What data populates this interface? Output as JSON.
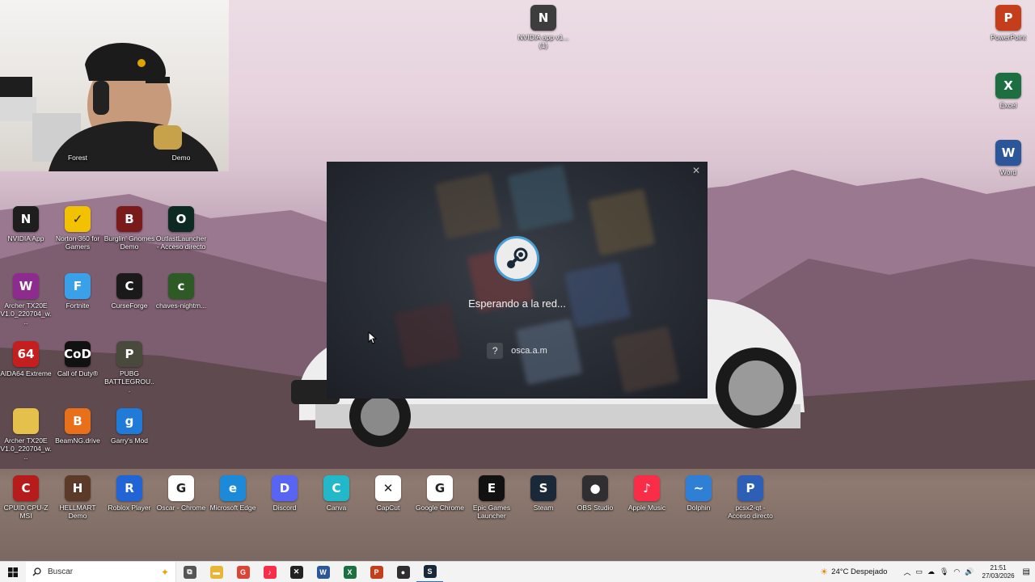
{
  "desktop_icons": [
    {
      "label": "",
      "color": "#2c2c2c",
      "glyph": ""
    },
    {
      "label": "NVIDIA app v1... (1)",
      "color": "#3d3d3d",
      "glyph": "N"
    },
    {
      "label": "PowerPoint",
      "color": "#c43e1c",
      "glyph": "P"
    },
    {
      "label": "Excel",
      "color": "#1d6f42",
      "glyph": "X"
    },
    {
      "label": "Word",
      "color": "#2b579a",
      "glyph": "W"
    },
    {
      "label": "Forest",
      "color": "#000",
      "glyph": ""
    },
    {
      "label": "Demo",
      "color": "#000",
      "glyph": ""
    },
    {
      "label": "NVIDIA App",
      "color": "#1e1e1e",
      "glyph": "N"
    },
    {
      "label": "Norton 360 for Gamers",
      "color": "#f2c200",
      "glyph": "✓"
    },
    {
      "label": "Burglin' Gnomes Demo",
      "color": "#7a1b1b",
      "glyph": "B"
    },
    {
      "label": "OutlastLauncher - Acceso directo",
      "color": "#0d2a22",
      "glyph": "O"
    },
    {
      "label": "Archer TX20E V1.0_220704_w...",
      "color": "#8e2b8e",
      "glyph": "W"
    },
    {
      "label": "Fortnite",
      "color": "#3aa0e8",
      "glyph": "F"
    },
    {
      "label": "CurseForge",
      "color": "#1a1a1a",
      "glyph": "C"
    },
    {
      "label": "chaves-nightm...",
      "color": "#2e5a26",
      "glyph": "c"
    },
    {
      "label": "AIDA64 Extreme",
      "color": "#c41e1e",
      "glyph": "64"
    },
    {
      "label": "Call of Duty®",
      "color": "#111",
      "glyph": "CoD"
    },
    {
      "label": "PUBG BATTLEGROU...",
      "color": "#4a4a3c",
      "glyph": "P"
    },
    {
      "label": "Archer TX20E V1.0_220704_w...",
      "color": "#e5c04a",
      "glyph": ""
    },
    {
      "label": "BeamNG.drive",
      "color": "#e8701b",
      "glyph": "B"
    },
    {
      "label": "Garry's Mod",
      "color": "#1f7ad8",
      "glyph": "g"
    },
    {
      "label": "CPUID CPU-Z MSI",
      "color": "#b71c1c",
      "glyph": "C"
    },
    {
      "label": "HELLMART Demo",
      "color": "#5b3a2a",
      "glyph": "H"
    },
    {
      "label": "Roblox Player",
      "color": "#2164d6",
      "glyph": "R"
    },
    {
      "label": "Oscar - Chrome",
      "color": "#ffffff",
      "glyph": "G"
    },
    {
      "label": "Microsoft Edge",
      "color": "#1b8ad8",
      "glyph": "e"
    },
    {
      "label": "Discord",
      "color": "#5865f2",
      "glyph": "D"
    },
    {
      "label": "Canva",
      "color": "#22b7c9",
      "glyph": "C"
    },
    {
      "label": "CapCut",
      "color": "#ffffff",
      "glyph": "✕"
    },
    {
      "label": "Google Chrome",
      "color": "#ffffff",
      "glyph": "G"
    },
    {
      "label": "Epic Games Launcher",
      "color": "#111111",
      "glyph": "E"
    },
    {
      "label": "Steam",
      "color": "#1b2838",
      "glyph": "S"
    },
    {
      "label": "OBS Studio",
      "color": "#302e31",
      "glyph": "●"
    },
    {
      "label": "Apple Music",
      "color": "#fa2d48",
      "glyph": "♪"
    },
    {
      "label": "Dolphin",
      "color": "#2f7fd6",
      "glyph": "~"
    },
    {
      "label": "pcsx2-qt - Acceso directo",
      "color": "#2d5fb7",
      "glyph": "P"
    }
  ],
  "steam_dialog": {
    "status_text": "Esperando a la red...",
    "account_name": "osca.a.m",
    "account_help_glyph": "?",
    "close_glyph": "✕"
  },
  "taskbar": {
    "search_placeholder": "Buscar",
    "pinned": [
      {
        "name": "task-view",
        "color": "#555",
        "glyph": "⧉"
      },
      {
        "name": "file-explorer",
        "color": "#e8b535",
        "glyph": "▬"
      },
      {
        "name": "chrome",
        "color": "#db4437",
        "glyph": "G"
      },
      {
        "name": "apple-music",
        "color": "#fa2d48",
        "glyph": "♪"
      },
      {
        "name": "capcut",
        "color": "#222",
        "glyph": "✕"
      },
      {
        "name": "word",
        "color": "#2b579a",
        "glyph": "W"
      },
      {
        "name": "excel",
        "color": "#1d6f42",
        "glyph": "X"
      },
      {
        "name": "powerpoint",
        "color": "#c43e1c",
        "glyph": "P"
      },
      {
        "name": "obs",
        "color": "#302e31",
        "glyph": "●"
      },
      {
        "name": "steam",
        "color": "#1b2838",
        "glyph": "S"
      }
    ],
    "weather": "24°C  Despejado",
    "time": "21:51",
    "date": "27/03/2026"
  }
}
